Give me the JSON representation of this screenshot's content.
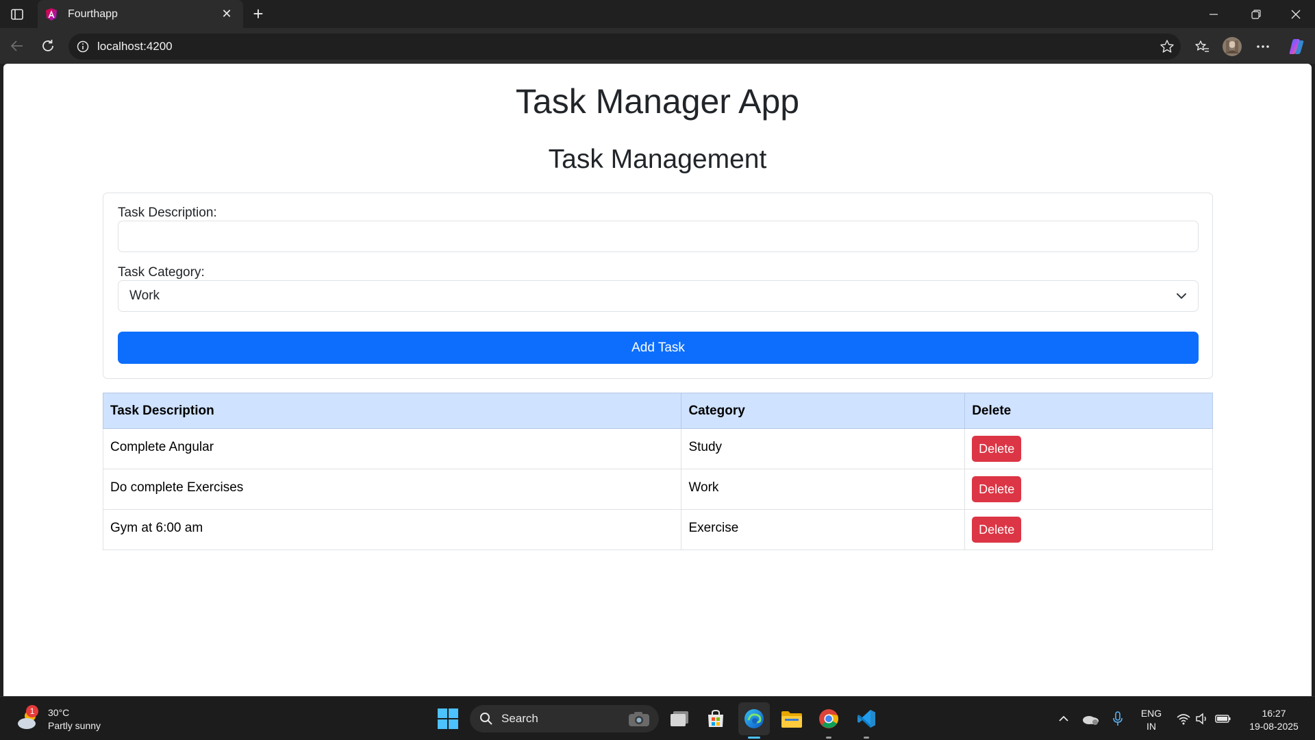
{
  "browser": {
    "tab_title": "Fourthapp",
    "url": "localhost:4200"
  },
  "page": {
    "app_title": "Task Manager App",
    "section_title": "Task Management",
    "form": {
      "description_label": "Task Description:",
      "description_value": "",
      "category_label": "Task Category:",
      "category_value": "Work",
      "add_button": "Add Task"
    },
    "table": {
      "headers": [
        "Task Description",
        "Category",
        "Delete"
      ],
      "rows": [
        {
          "description": "Complete Angular",
          "category": "Study",
          "action": "Delete"
        },
        {
          "description": "Do complete Exercises",
          "category": "Work",
          "action": "Delete"
        },
        {
          "description": "Gym at 6:00 am",
          "category": "Exercise",
          "action": "Delete"
        }
      ]
    }
  },
  "taskbar": {
    "weather_temp": "30°C",
    "weather_desc": "Partly sunny",
    "weather_badge": "1",
    "search_label": "Search",
    "lang_line1": "ENG",
    "lang_line2": "IN",
    "time": "16:27",
    "date": "19-08-2025"
  },
  "colors": {
    "primary": "#0d6efd",
    "danger": "#dc3545",
    "table_header": "#cfe2ff"
  }
}
